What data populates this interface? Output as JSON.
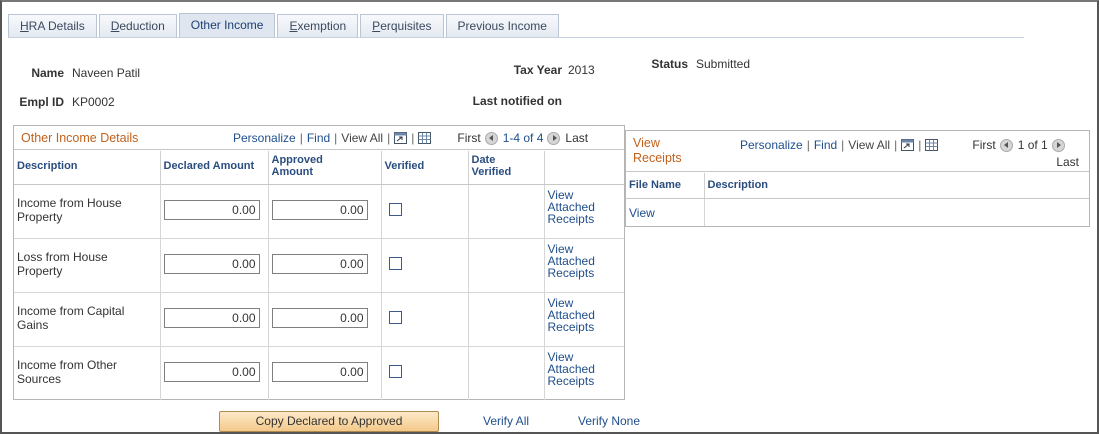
{
  "tabs": [
    {
      "label": "HRA Details",
      "u": "H",
      "rest": "RA Details"
    },
    {
      "label": "Deduction",
      "u": "D",
      "rest": "eduction"
    },
    {
      "label": "Other Income",
      "u": "",
      "rest": "Other Income"
    },
    {
      "label": "Exemption",
      "u": "E",
      "rest": "xemption"
    },
    {
      "label": "Perquisites",
      "u": "P",
      "rest": "erquisites"
    },
    {
      "label": "Previous Income",
      "u": "",
      "rest": "Previous Income"
    }
  ],
  "header": {
    "name_label": "Name",
    "name_value": "Naveen Patil",
    "empl_label": "Empl ID",
    "empl_value": "KP0002",
    "taxyear_label": "Tax Year",
    "taxyear_value": "2013",
    "status_label": "Status",
    "status_value": "Submitted",
    "notified_label": "Last notified on"
  },
  "income_grid": {
    "title": "Other Income Details",
    "personalize": "Personalize",
    "find": "Find",
    "view_all": "View All",
    "first": "First",
    "range": "1-4 of 4",
    "last": "Last",
    "columns": {
      "description": "Description",
      "declared": "Declared Amount",
      "approved_1": "Approved",
      "approved_2": "Amount",
      "verified": "Verified",
      "date_1": "Date",
      "date_2": "Verified"
    },
    "rows": [
      {
        "desc_1": "Income from House",
        "desc_2": "Property",
        "declared": "0.00",
        "approved": "0.00",
        "link_1": "View",
        "link_2": "Attached",
        "link_3": "Receipts"
      },
      {
        "desc_1": "Loss from House",
        "desc_2": "Property",
        "declared": "0.00",
        "approved": "0.00",
        "link_1": "View",
        "link_2": "Attached",
        "link_3": "Receipts"
      },
      {
        "desc_1": "Income from Capital",
        "desc_2": "Gains",
        "declared": "0.00",
        "approved": "0.00",
        "link_1": "View",
        "link_2": "Attached",
        "link_3": "Receipts"
      },
      {
        "desc_1": "Income from Other",
        "desc_2": "Sources",
        "declared": "0.00",
        "approved": "0.00",
        "link_1": "View",
        "link_2": "Attached",
        "link_3": "Receipts"
      }
    ]
  },
  "receipts_grid": {
    "title_1": "View",
    "title_2": "Receipts",
    "personalize": "Personalize",
    "find": "Find",
    "view_all": "View All",
    "first": "First",
    "range": "1 of 1",
    "last": "Last",
    "columns": {
      "file_name": "File Name",
      "description": "Description"
    },
    "rows": [
      {
        "file_name": "View",
        "description": ""
      }
    ]
  },
  "actions": {
    "copy_button": "Copy Declared to Approved",
    "verify_all": "Verify All",
    "verify_none": "Verify None"
  },
  "icons": {
    "zoom": "zoom-grid-icon",
    "download": "download-spreadsheet-icon",
    "prev": "previous-arrow-icon",
    "next": "next-arrow-icon"
  }
}
